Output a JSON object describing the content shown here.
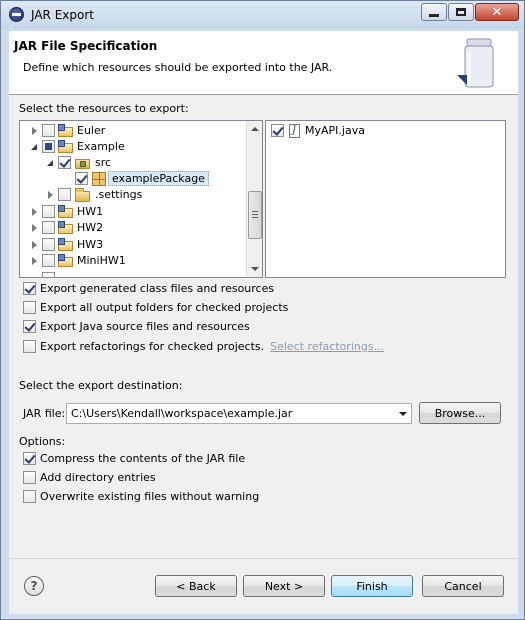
{
  "window": {
    "title": "JAR Export",
    "minimize_icon": "minimize-icon",
    "maximize_icon": "maximize-icon",
    "close_icon": "close-icon",
    "close_glyph": "✕"
  },
  "banner": {
    "title": "JAR File Specification",
    "description": "Define which resources should be exported into the JAR."
  },
  "resources": {
    "label": "Select the resources to export:",
    "tree": [
      {
        "label": "Euler",
        "checked": false,
        "expanded": false,
        "icon": "java-project-icon"
      },
      {
        "label": "Example",
        "checked": "partial",
        "expanded": true,
        "icon": "java-project-icon"
      },
      {
        "label": "src",
        "checked": true,
        "expanded": true,
        "icon": "source-folder-icon"
      },
      {
        "label": "examplePackage",
        "checked": true,
        "selected": true,
        "icon": "package-icon"
      },
      {
        "label": ".settings",
        "checked": false,
        "expanded": false,
        "icon": "folder-icon"
      },
      {
        "label": "HW1",
        "checked": false,
        "expanded": false,
        "icon": "java-project-icon"
      },
      {
        "label": "HW2",
        "checked": false,
        "expanded": false,
        "icon": "java-project-icon"
      },
      {
        "label": "HW3",
        "checked": false,
        "expanded": false,
        "icon": "java-project-icon"
      },
      {
        "label": "MiniHW1",
        "checked": false,
        "expanded": false,
        "icon": "java-project-icon"
      }
    ],
    "files": [
      {
        "label": "MyAPI.java",
        "checked": true,
        "icon": "java-file-icon"
      }
    ]
  },
  "export_options": [
    {
      "label": "Export generated class files and resources",
      "checked": true
    },
    {
      "label": "Export all output folders for checked projects",
      "checked": false
    },
    {
      "label": "Export Java source files and resources",
      "checked": true
    },
    {
      "label": "Export refactorings for checked projects.",
      "checked": false
    }
  ],
  "refactorings_link": "Select refactorings...",
  "destination": {
    "label": "Select the export destination:",
    "jar_label": "JAR file:",
    "jar_value": "C:\\Users\\Kendall\\workspace\\example.jar",
    "browse": "Browse..."
  },
  "options": {
    "label": "Options:",
    "items": [
      {
        "label": "Compress the contents of the JAR file",
        "checked": true
      },
      {
        "label": "Add directory entries",
        "checked": false
      },
      {
        "label": "Overwrite existing files without warning",
        "checked": false
      }
    ]
  },
  "buttons": {
    "help_glyph": "?",
    "back": "< Back",
    "next": "Next >",
    "finish": "Finish",
    "cancel": "Cancel"
  },
  "colors": {
    "frame": "#cfdcec",
    "link_disabled": "#8a9bb0",
    "default_button": "#3c7fb1"
  }
}
